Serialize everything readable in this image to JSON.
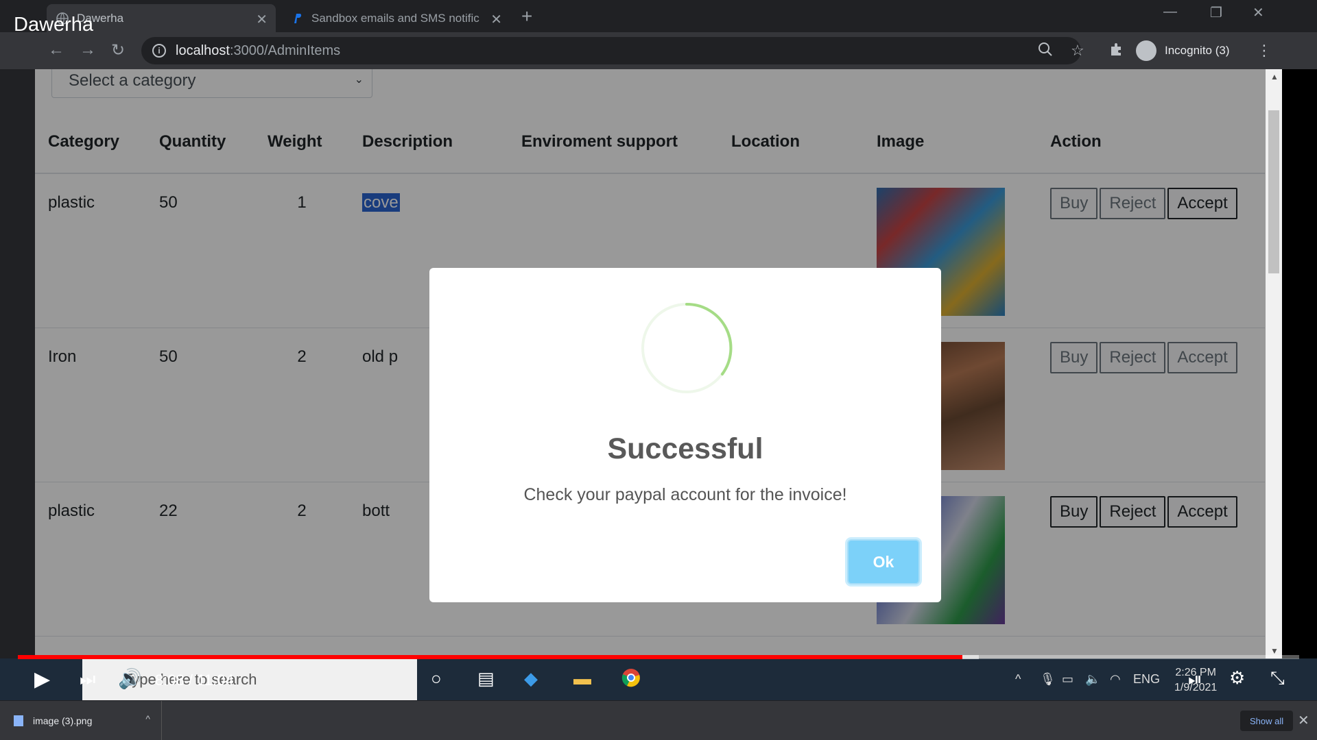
{
  "video": {
    "title": "Dawerha",
    "time": "8:08 / 11:04",
    "progress": 0.737,
    "buffered": 0.7
  },
  "tabs": [
    {
      "label": "Dawerha",
      "active": true
    },
    {
      "label": "Sandbox emails and SMS notific",
      "active": false
    }
  ],
  "address": {
    "host": "localhost",
    "path": ":3000/AdminItems"
  },
  "profile": {
    "label": "Incognito (3)"
  },
  "filter": {
    "placeholder": "Select a category"
  },
  "table": {
    "headers": [
      "Category",
      "Quantity",
      "Weight",
      "Description",
      "Enviroment support",
      "Location",
      "Image",
      "Action"
    ],
    "rows": [
      {
        "category": "plastic",
        "quantity": "50",
        "weight": "1",
        "description": "cove",
        "highlight": true,
        "image_color": "#3a7fc0"
      },
      {
        "category": "Iron",
        "quantity": "50",
        "weight": "2",
        "description": "old p",
        "highlight": false,
        "image_color": "#8a5a3c"
      },
      {
        "category": "plastic",
        "quantity": "22",
        "weight": "2",
        "description": "bott",
        "highlight": false,
        "image_color": "#3b3f7a"
      }
    ],
    "actions": {
      "buy": "Buy",
      "reject": "Reject",
      "accept": "Accept"
    }
  },
  "modal": {
    "title": "Successful",
    "text": "Check your paypal account for the invoice!",
    "ok": "Ok"
  },
  "taskbar": {
    "search_placeholder": "Type here to search",
    "lang": "ENG",
    "time": "2:26 PM",
    "date": "1/9/2021"
  },
  "downloads": {
    "file": "image (3).png",
    "show_all": "Show all"
  },
  "colors": {
    "accent": "#7cd1f9",
    "progress": "#ff0000",
    "spinner": "#a5dc86"
  }
}
